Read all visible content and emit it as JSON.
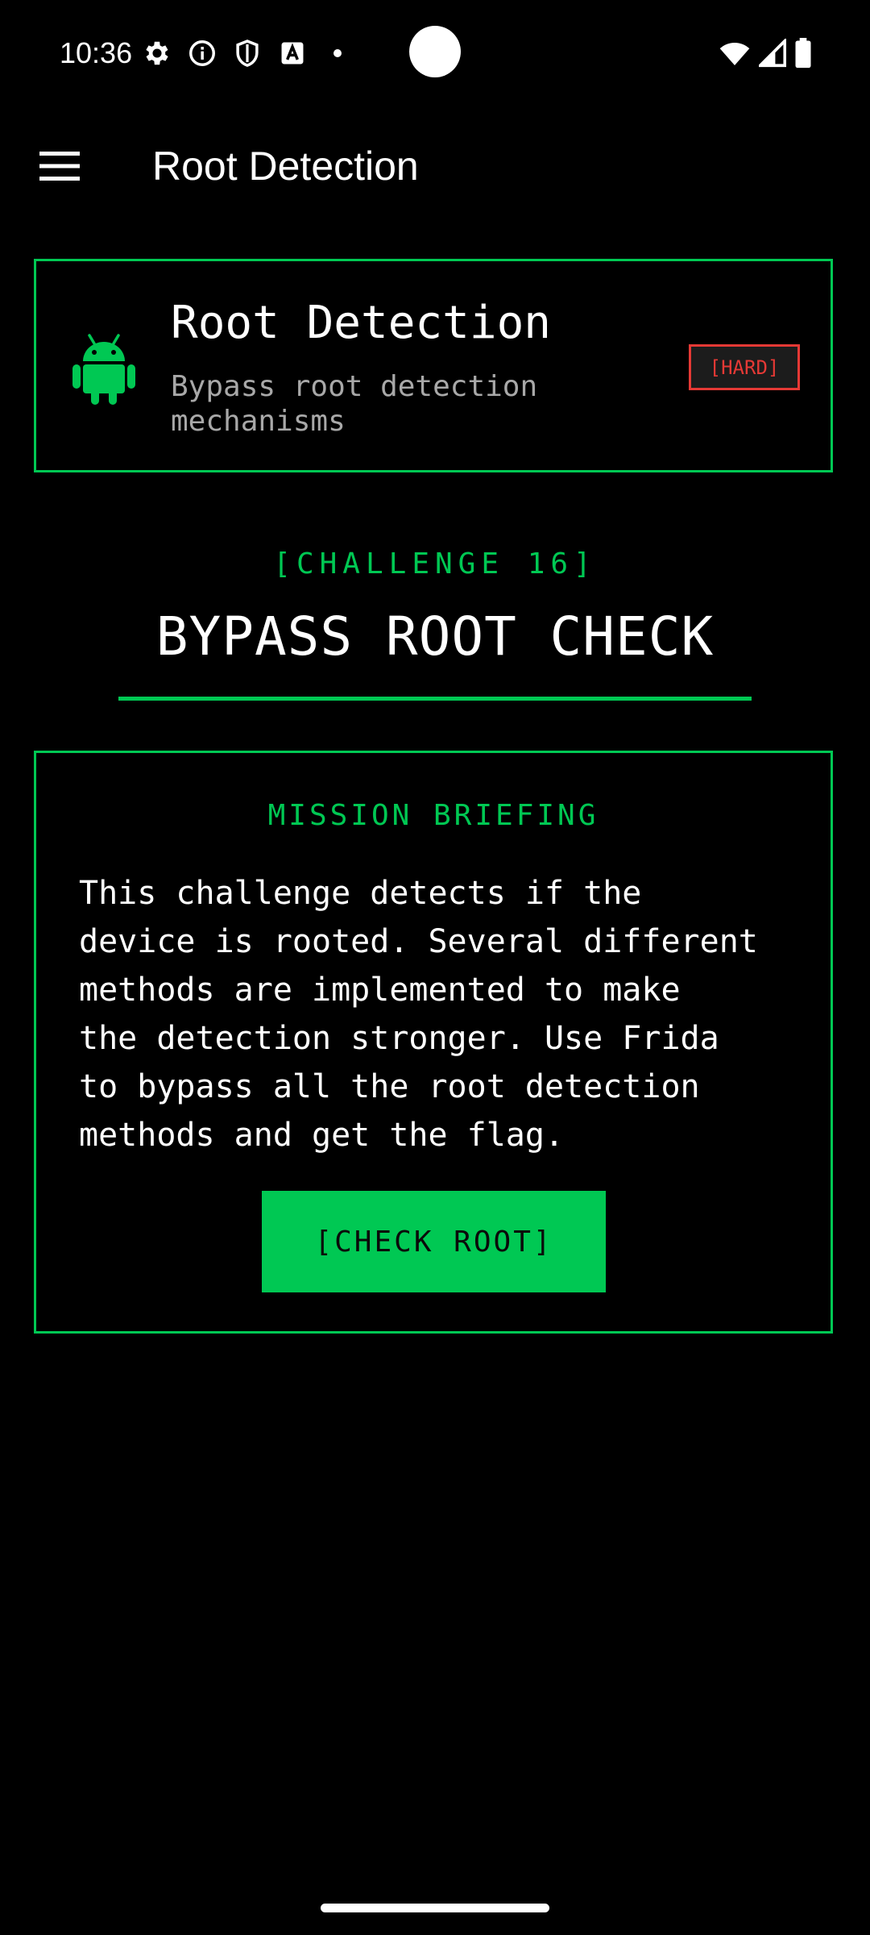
{
  "status_bar": {
    "time": "10:36",
    "left_icons": [
      "gear-icon",
      "info-icon",
      "shield-icon",
      "font-icon",
      "notification-dot-icon"
    ],
    "right_icons": [
      "wifi-icon",
      "signal-icon",
      "battery-icon"
    ]
  },
  "app_bar": {
    "title": "Root Detection",
    "menu_icon": "hamburger-menu-icon"
  },
  "challenge_card": {
    "title": "Root Detection",
    "subtitle": "Bypass root detection mechanisms",
    "difficulty": "[HARD]",
    "icon": "android-icon"
  },
  "challenge": {
    "label": "[CHALLENGE 16]",
    "heading": "BYPASS ROOT CHECK"
  },
  "briefing": {
    "title": "MISSION BRIEFING",
    "text": "This challenge detects if the\ndevice is rooted. Several different\nmethods are implemented to make\nthe detection stronger. Use Frida\nto bypass all the root detection\nmethods and get the flag.",
    "button_label": "[CHECK ROOT]"
  },
  "colors": {
    "accent": "#00c853",
    "danger": "#e53935",
    "background": "#000000",
    "muted_text": "#a8a8a8"
  }
}
